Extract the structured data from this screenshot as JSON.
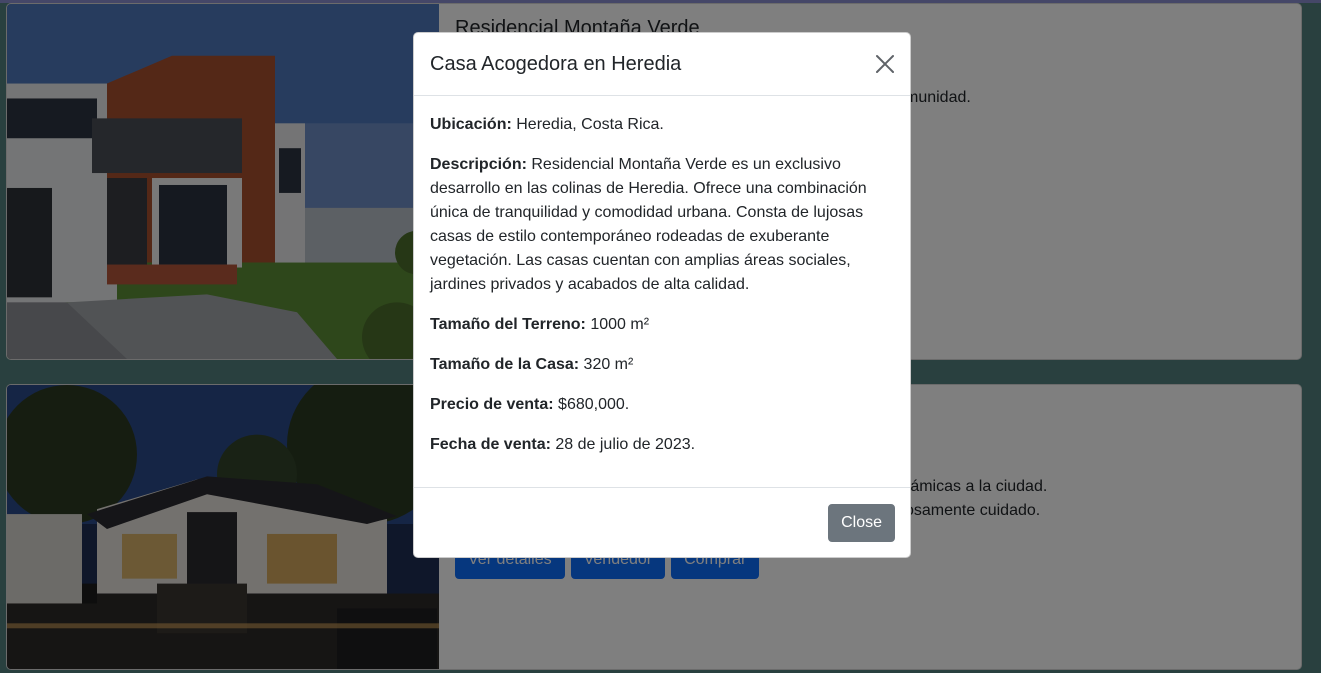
{
  "cards": [
    {
      "title": "Residencial Montaña Verde",
      "visible_text_fragment": "munidad."
    },
    {
      "visible_text_line1": "rámicas a la ciudad.",
      "visible_text_line2": "osamente cuidado.",
      "buttons": [
        "Ver detalles",
        "Vendedor",
        "Comprar"
      ]
    }
  ],
  "modal": {
    "title": "Casa Acogedora en Heredia",
    "fields": [
      {
        "label": "Ubicación:",
        "value": " Heredia, Costa Rica."
      },
      {
        "label": "Descripción:",
        "value": " Residencial Montaña Verde es un exclusivo desarrollo en las colinas de Heredia. Ofrece una combinación única de tranquilidad y comodidad urbana. Consta de lujosas casas de estilo contemporáneo rodeadas de exuberante vegetación. Las casas cuentan con amplias áreas sociales, jardines privados y acabados de alta calidad."
      },
      {
        "label": "Tamaño del Terreno:",
        "value": " 1000 m²"
      },
      {
        "label": "Tamaño de la Casa:",
        "value": " 320 m²"
      },
      {
        "label": "Precio de venta:",
        "value": " $680,000."
      },
      {
        "label": "Fecha de venta:",
        "value": " 28 de julio de 2023."
      }
    ],
    "close_label": "Close",
    "close_icon": "close-icon"
  },
  "colors": {
    "page_background": "#52817f",
    "primary_button": "#0d6efd",
    "secondary_button": "#6c757d",
    "backdrop": "rgba(0,0,0,0.5)"
  }
}
